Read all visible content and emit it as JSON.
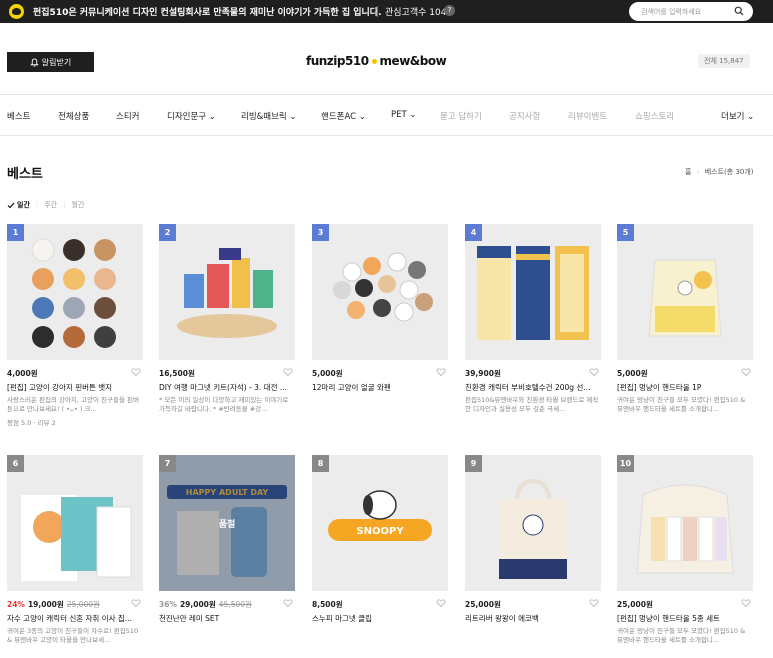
{
  "topbar": {
    "announce": "펀집510은 커뮤니케이션 디자인 컨설팅회사로 만족물의 재미난 이야기가 가득한 집 입니다.",
    "interest_label": "관심고객수 104",
    "help": "?",
    "search_placeholder": "검색어를 입력하세요"
  },
  "header": {
    "notify_label": "알림받기",
    "brand_left": "funzip510",
    "brand_right": "mew&bow",
    "total": "전체 15,847"
  },
  "nav": {
    "items": [
      {
        "label": "베스트"
      },
      {
        "label": "전체상품"
      },
      {
        "label": "스티커"
      },
      {
        "label": "디자인문구 ⌄"
      },
      {
        "label": "리빙&패브릭 ⌄"
      },
      {
        "label": "핸드폰AC ⌄"
      },
      {
        "label": "PET ⌄"
      },
      {
        "label": "묻고 답하기"
      },
      {
        "label": "공지사항"
      },
      {
        "label": "리뷰이벤트"
      },
      {
        "label": "쇼핑스토리"
      },
      {
        "label": "더보기 ⌄"
      }
    ]
  },
  "page": {
    "title": "베스트",
    "crumb_home": "홈",
    "crumb_current": "베스트(총 30개)"
  },
  "period": {
    "daily": "일간",
    "weekly": "주간",
    "monthly": "월간"
  },
  "products": [
    {
      "rank": "1",
      "price": "4,000원",
      "name": "[펀집] 고양이 강아지 핀버튼 뱃지",
      "desc": "사랑스러운 펀집의 강아지, 고양이 친구들을 핀버튼으로 만나보세요! ( •ᴗ• ) 크...",
      "review": "평점 5.0 · 리뷰 2"
    },
    {
      "rank": "2",
      "price": "16,500원",
      "name": "DIY 여행 마그넷 키트(자석) - 3. 대전 ...",
      "desc": "* 모든 이의 일상이 다양하고 재미있는 이야기로 가득하길 바랍니다. * #반려동물 #강...",
      "review": ""
    },
    {
      "rank": "3",
      "price": "5,000원",
      "name": "12마리 고양이 얼굴 와펜",
      "desc": "",
      "review": ""
    },
    {
      "rank": "4",
      "price": "39,900원",
      "name": "친환경 캐릭터 부비호텔수건 200g 선...",
      "desc": "펀집510&뮤앤바우와 친환경 타월 브랜드로 제작한 디자인과 실용성 모두 갖춘 극세...",
      "review": ""
    },
    {
      "rank": "5",
      "price": "5,000원",
      "name": "[펀집] 멍냥이 핸드타올 1P",
      "desc": "귀여운 멍냥이 친구들 모두 모였다! 펀집510 & 뮤앤바우 핸드타올 세트를 소개합니...",
      "review": ""
    },
    {
      "rank": "6",
      "disc": "24%",
      "price": "19,000원",
      "orig": "25,000원",
      "name": "자수 고양이 캐릭터 신혼 자취 이사 집...",
      "desc": "귀여운 3종의 고양이 친구들이 자수로! 펀집510 & 뮤앤바우 고양이 타올을 만나보세...",
      "review": ""
    },
    {
      "rank": "7",
      "disc": "36%",
      "price": "29,000원",
      "orig": "45,500원",
      "name": "천진난만 레미 SET",
      "desc": "",
      "review": "",
      "soldout": "품절"
    },
    {
      "rank": "8",
      "price": "8,500원",
      "name": "스누피 마그넷 클립",
      "desc": "",
      "review": ""
    },
    {
      "rank": "9",
      "price": "25,000원",
      "name": "리트리버 왕왕이 에코백",
      "desc": "",
      "review": ""
    },
    {
      "rank": "10",
      "price": "25,000원",
      "name": "[펀집] 멍냥이 핸드타올 5종 세트",
      "desc": "귀여운 멍냥이 친구들 모두 모였다! 펀집510 & 뮤앤바우 핸드타올 세트를 소개합니...",
      "review": ""
    }
  ],
  "product7_banner": "HAPPY ADULT DAY",
  "product8_label": "SNOOPY",
  "colors": {
    "rank_bg": "#5b7bd5",
    "discount": "#e53935",
    "topbar": "#1f1f1f"
  }
}
